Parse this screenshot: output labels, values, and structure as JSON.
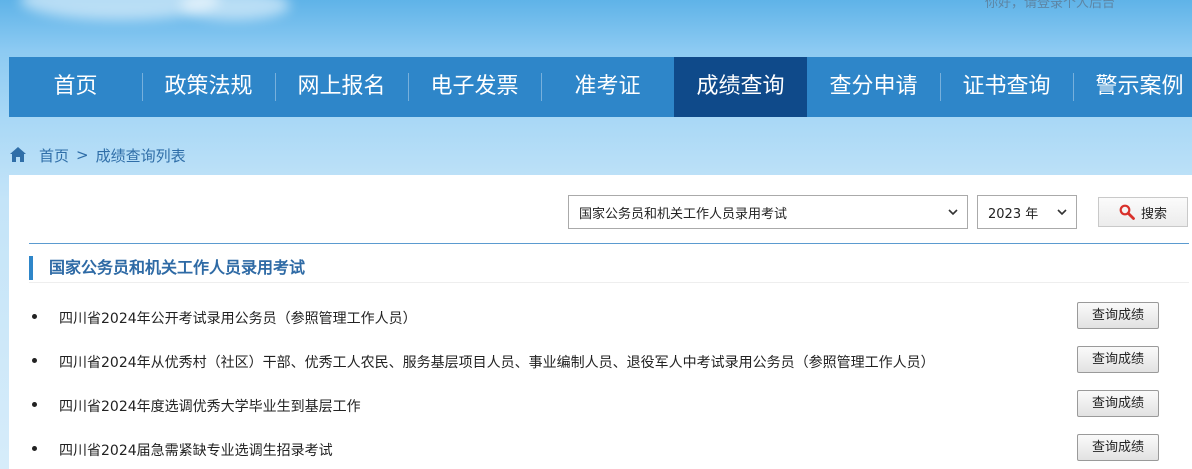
{
  "header": {
    "top_text": "你好，请登录个人后台"
  },
  "nav": {
    "items": [
      "首页",
      "政策法规",
      "网上报名",
      "电子发票",
      "准考证",
      "成绩查询",
      "查分申请",
      "证书查询",
      "警示案例"
    ],
    "active": "成绩查询"
  },
  "breadcrumb": {
    "home": "首页",
    "separator": ">",
    "current": "成绩查询列表"
  },
  "filters": {
    "exam_select": "国家公务员和机关工作人员录用考试",
    "year_select": "2023 年",
    "search_label": "搜索"
  },
  "section": {
    "title": "国家公务员和机关工作人员录用考试",
    "items": [
      {
        "text": "四川省2024年公开考试录用公务员（参照管理工作人员）",
        "button": "查询成绩"
      },
      {
        "text": "四川省2024年从优秀村（社区）干部、优秀工人农民、服务基层项目人员、事业编制人员、退役军人中考试录用公务员（参照管理工作人员）",
        "button": "查询成绩"
      },
      {
        "text": "四川省2024年度选调优秀大学毕业生到基层工作",
        "button": "查询成绩"
      },
      {
        "text": "四川省2024届急需紧缺专业选调生招录考试",
        "button": "查询成绩"
      }
    ]
  },
  "colors": {
    "nav_bg": "#2e86c9",
    "nav_active": "#0f4a8a",
    "link": "#2f6ea8",
    "search_icon": "#d9312b"
  }
}
